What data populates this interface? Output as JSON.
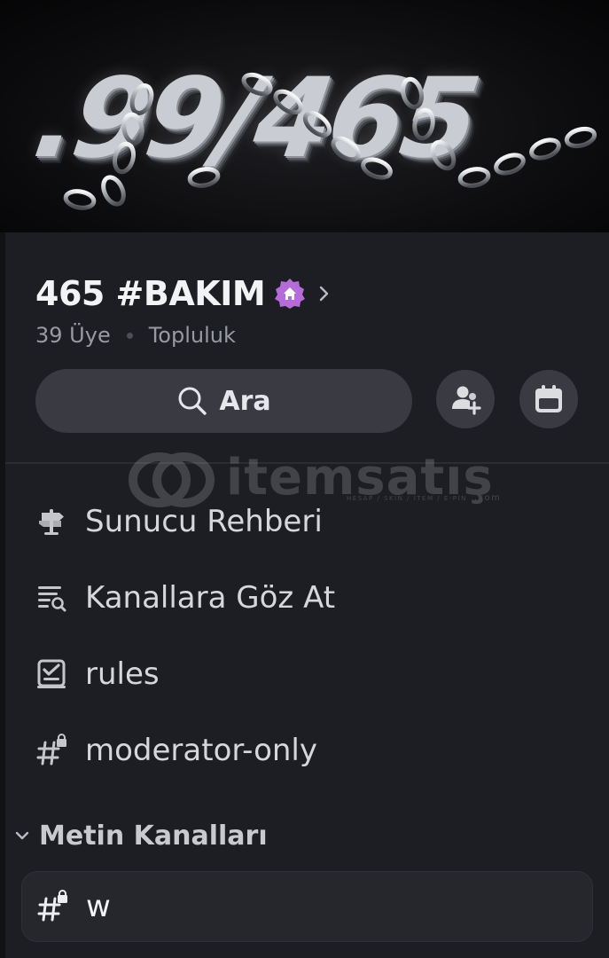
{
  "banner": {
    "text": ".99/465",
    "icon": "chained-logo-banner"
  },
  "server": {
    "name": "465 #BAKIM",
    "badge_icon": "community-home-badge-icon",
    "member_count": "39 Üye",
    "type": "Topluluk"
  },
  "actions": {
    "search_label": "Ara",
    "invite_icon": "add-member-icon",
    "events_icon": "calendar-icon"
  },
  "watermark": {
    "text": "itemsatış",
    "sub": "HESAP / SKIN / ITEM / E-PIN",
    "domain": ".com"
  },
  "channels": [
    {
      "label": "Sunucu Rehberi",
      "icon": "signpost-icon"
    },
    {
      "label": "Kanallara Göz At",
      "icon": "browse-channels-icon"
    },
    {
      "label": "rules",
      "icon": "rules-checkbox-icon"
    },
    {
      "label": "moderator-only",
      "icon": "locked-hash-icon"
    }
  ],
  "category": {
    "label": "Metin Kanalları",
    "icon": "chevron-down-icon",
    "channels": [
      {
        "label": "w",
        "icon": "locked-hash-icon"
      }
    ]
  },
  "colors": {
    "background": "#1d1e23",
    "button": "#393a42",
    "badge": "#b56cd9",
    "text_primary": "#f2f3f5",
    "text_muted": "#989aa2"
  }
}
